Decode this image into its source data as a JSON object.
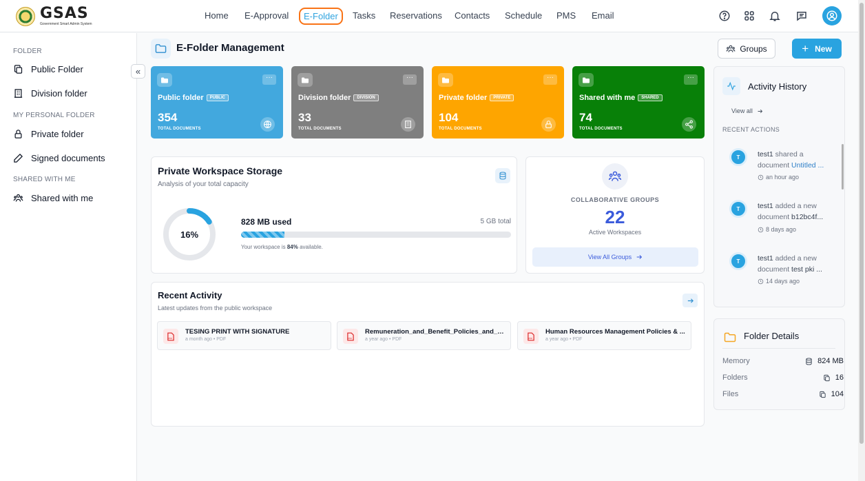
{
  "app": {
    "logo_text": "GSAS",
    "logo_subtitle": "Government Smart Admin System"
  },
  "nav": {
    "items": [
      {
        "label": "Home"
      },
      {
        "label": "E-Approval"
      },
      {
        "label": "E-Folder",
        "active": true
      },
      {
        "label": "Tasks"
      },
      {
        "label": "Reservations"
      },
      {
        "label": "Contacts"
      },
      {
        "label": "Schedule"
      },
      {
        "label": "PMS"
      },
      {
        "label": "Email"
      }
    ],
    "icons": [
      "help-icon",
      "apps-grid-icon",
      "bell-icon",
      "chat-icon",
      "user-avatar-icon"
    ]
  },
  "sidebar": {
    "sections": [
      {
        "heading": "FOLDER",
        "items": [
          {
            "label": "Public Folder",
            "icon": "copy-icon"
          },
          {
            "label": "Division folder",
            "icon": "building-icon"
          }
        ]
      },
      {
        "heading": "MY PERSONAL FOLDER",
        "items": [
          {
            "label": "Private folder",
            "icon": "lock-icon"
          },
          {
            "label": "Signed documents",
            "icon": "pen-icon"
          }
        ]
      },
      {
        "heading": "SHARED WITH ME",
        "items": [
          {
            "label": "Shared with me",
            "icon": "users-icon"
          }
        ]
      }
    ],
    "collapse_icon": "«"
  },
  "header": {
    "title": "E-Folder Management",
    "groups_button": "Groups",
    "new_button": "New"
  },
  "cards": [
    {
      "title": "Public folder",
      "badge": "PUBLIC",
      "count": "354",
      "label": "TOTAL DOCUMENTS",
      "color": "#42a8de",
      "icon": "globe-icon"
    },
    {
      "title": "Division folder",
      "badge": "DIVISION",
      "count": "33",
      "label": "TOTAL DOCUMENTS",
      "color": "#7f7f7f",
      "icon": "building-icon"
    },
    {
      "title": "Private folder",
      "badge": "PRIVATE",
      "count": "104",
      "label": "TOTAL DOCUMENTS",
      "color": "#fea500",
      "icon": "lock-icon"
    },
    {
      "title": "Shared with me",
      "badge": "SHARED",
      "count": "74",
      "label": "TOTAL DOCUMENTS",
      "color": "#088008",
      "icon": "share-icon"
    }
  ],
  "storage": {
    "title": "Private Workspace Storage",
    "subtitle": "Analysis of your total capacity",
    "percent_label": "16%",
    "percent_used": 0.16,
    "used_label": "828 MB used",
    "total_label": "5 GB total",
    "available_prefix": "Your workspace is ",
    "available_pct": "84%",
    "available_suffix": " available."
  },
  "groups": {
    "heading": "COLLABORATIVE GROUPS",
    "count": "22",
    "subtitle": "Active Workspaces",
    "button": "View All Groups"
  },
  "recent": {
    "title": "Recent Activity",
    "subtitle": "Latest updates from the public workspace",
    "items": [
      {
        "name": "TESING PRINT WITH SIGNATURE",
        "meta": "a month ago • PDF"
      },
      {
        "name": "Remuneration_and_Benefit_Policies_and_Pr...",
        "meta": "a year ago • PDF"
      },
      {
        "name": "Human Resources Management Policies & ...",
        "meta": "a year ago • PDF"
      }
    ]
  },
  "activity_history": {
    "title": "Activity History",
    "view_all": "View all",
    "recent_heading": "RECENT ACTIONS",
    "items": [
      {
        "avatar": "T",
        "user": "test1",
        "action": " shared a document ",
        "doc": "Untitled ...",
        "time": "an hour ago"
      },
      {
        "avatar": "T",
        "user": "test1",
        "action": " added a new document ",
        "doc": "b12bc4f...",
        "time": "8 days ago"
      },
      {
        "avatar": "T",
        "user": "test1",
        "action": " added a new document ",
        "doc": "test pki ...",
        "time": "14 days ago"
      }
    ]
  },
  "folder_details": {
    "title": "Folder Details",
    "rows": [
      {
        "label": "Memory",
        "value": "824 MB",
        "icon": "database-icon"
      },
      {
        "label": "Folders",
        "value": "16",
        "icon": "copy-icon"
      },
      {
        "label": "Files",
        "value": "104",
        "icon": "copy-icon"
      }
    ]
  }
}
